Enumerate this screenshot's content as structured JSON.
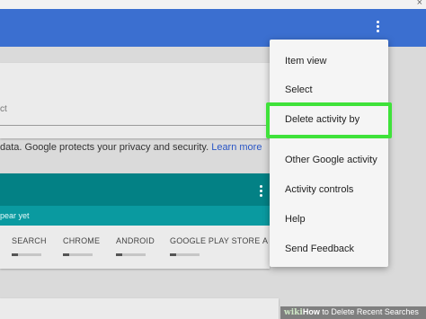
{
  "top_bar": {
    "close_glyph": "×"
  },
  "search_card": {
    "field_text": "ct"
  },
  "privacy": {
    "text": "data. Google protects your privacy and security. ",
    "link": "Learn more"
  },
  "results": {
    "notice": "pear yet",
    "filters": [
      "SEARCH",
      "CHROME",
      "ANDROID",
      "GOOGLE PLAY STORE",
      "A"
    ]
  },
  "menu": {
    "items": [
      "Item view",
      "Select",
      "Delete activity by",
      "Other Google activity",
      "Activity controls",
      "Help",
      "Send Feedback"
    ]
  },
  "watermark": {
    "brand": "wiki",
    "how": "How",
    "rest": " to Delete Recent Searches"
  },
  "colors": {
    "blue_header": "#3b6fd0",
    "teal_header": "#038185",
    "highlight": "#3fe23a",
    "link": "#2a56c6"
  }
}
